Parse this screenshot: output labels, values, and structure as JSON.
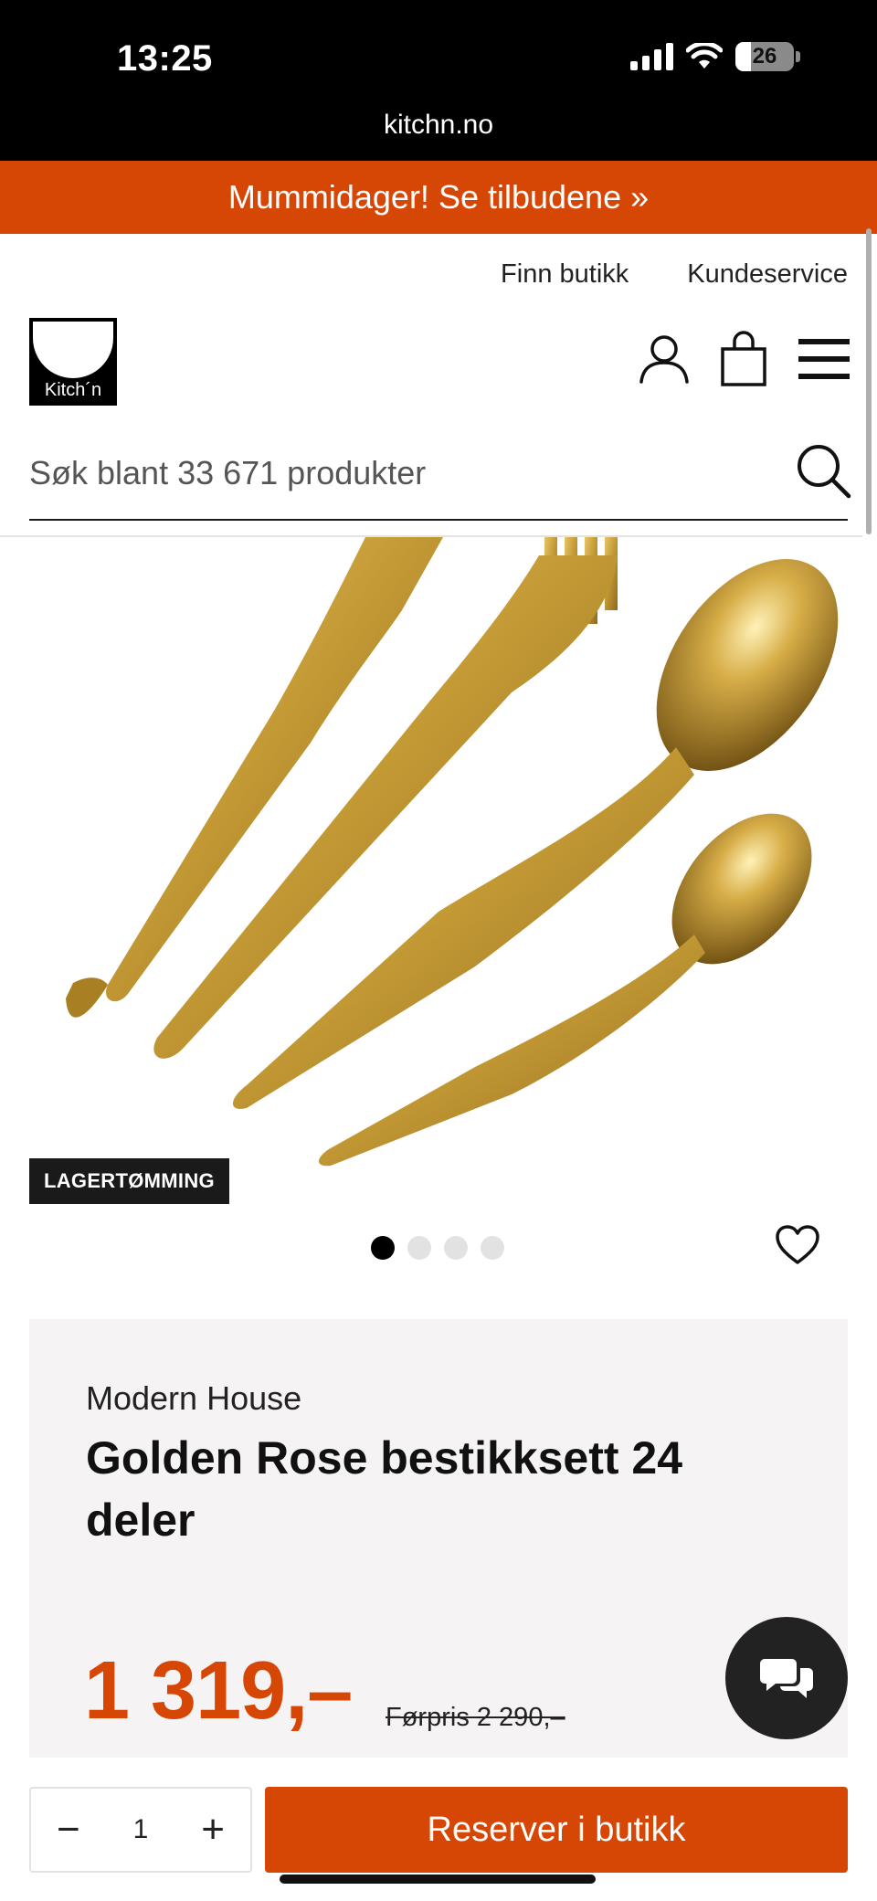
{
  "status_bar": {
    "time": "13:25",
    "battery": "26"
  },
  "browser": {
    "url": "kitchn.no"
  },
  "promo": {
    "text": "Mummidager! Se tilbudene »"
  },
  "header": {
    "links": [
      "Finn butikk",
      "Kundeservice"
    ],
    "logo_text": "Kitch´n",
    "search_placeholder": "Søk blant 33 671 produkter"
  },
  "product": {
    "badge": "LAGERTØMMING",
    "image_count": 4,
    "active_image": 1,
    "brand": "Modern House",
    "title": "Golden Rose bestikksett 24 deler",
    "price": "1 319,–",
    "old_price": "Førpris 2 290,–"
  },
  "purchase": {
    "quantity": "1",
    "reserve_label": "Reserver i butikk"
  },
  "colors": {
    "accent": "#d64604",
    "dark": "#1a1a1a",
    "card_bg": "#f5f3f3",
    "gold": "#c9a23e"
  },
  "icons": [
    "user-icon",
    "shopping-bag-icon",
    "menu-icon",
    "search-icon",
    "heart-icon",
    "chat-icon",
    "minus-icon",
    "plus-icon"
  ]
}
